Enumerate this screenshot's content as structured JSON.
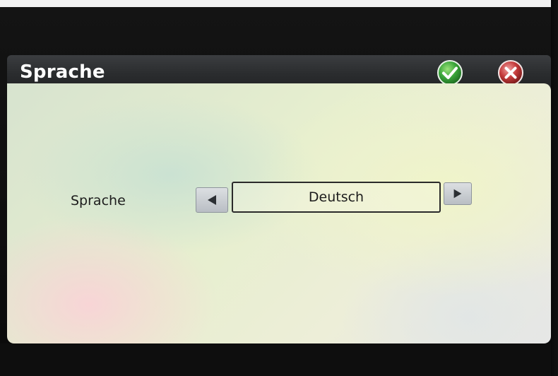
{
  "window": {
    "title": "Sprache"
  },
  "toolbar": {
    "ok_icon": "checkmark-icon",
    "cancel_icon": "close-icon",
    "ok_color": "#3aa53a",
    "cancel_color": "#c43a3a"
  },
  "setting": {
    "label": "Sprache",
    "value": "Deutsch",
    "prev_icon": "left-arrow-icon",
    "next_icon": "right-arrow-icon"
  }
}
